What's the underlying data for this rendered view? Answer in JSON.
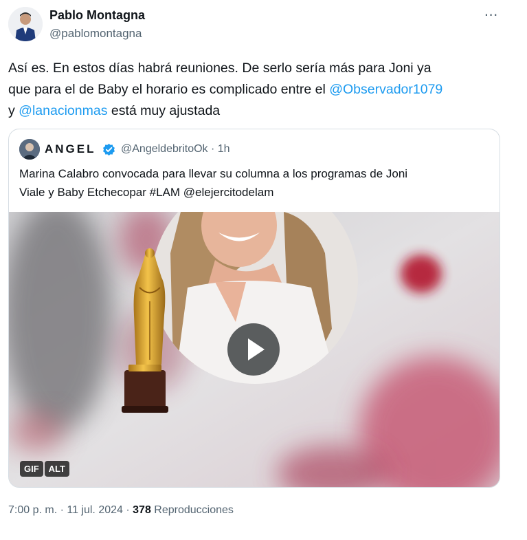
{
  "author": {
    "name": "Pablo Montagna",
    "handle": "@pablomontagna"
  },
  "menu": {
    "more_icon": "⋯"
  },
  "tweet": {
    "line1": "Así es. En estos días habrá reuniones. De serlo sería más para  Joni ya",
    "line2": "que para el de Baby el horario es complicado entre el ",
    "mention1": "@Observador1079",
    "line3_start": "y ",
    "mention2": "@lanacionmas",
    "line3_end": " está muy ajustada"
  },
  "quote": {
    "name": "ANGEL",
    "handle_time": "@AngeldebritoOk · 1h",
    "text_line1": "Marina Calabro convocada para llevar su columna a los programas de Joni",
    "text_line2": "Viale y Baby Etchecopar #LAM @elejercitodelam",
    "media": {
      "badge_gif": "GIF",
      "badge_alt": "ALT"
    }
  },
  "footer": {
    "timestamp": "7:00 p. m. · 11 jul. 2024 · ",
    "views": "378",
    "views_label": " Reproducciones"
  },
  "colors": {
    "mention": "#1d9bf0",
    "verified": "#1d9bf0",
    "secondary_text": "#536471"
  }
}
